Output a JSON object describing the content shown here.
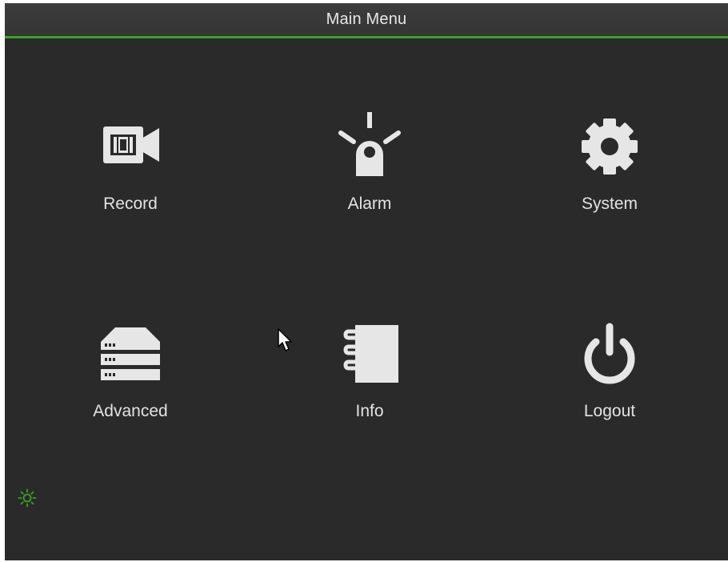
{
  "window": {
    "title": "Main Menu"
  },
  "menu": {
    "items": [
      {
        "label": "Record",
        "icon": "video-camera-icon"
      },
      {
        "label": "Alarm",
        "icon": "alarm-beacon-icon"
      },
      {
        "label": "System",
        "icon": "gear-icon"
      },
      {
        "label": "Advanced",
        "icon": "server-stack-icon"
      },
      {
        "label": "Info",
        "icon": "notebook-icon"
      },
      {
        "label": "Logout",
        "icon": "power-icon"
      }
    ]
  },
  "status": {
    "icon": "brightness-icon"
  },
  "colors": {
    "background": "#2a2a2a",
    "titlebar": "#3a3a3a",
    "accent": "#3aa51e",
    "icon": "#e6e6e6",
    "text": "#e3e3e3"
  }
}
